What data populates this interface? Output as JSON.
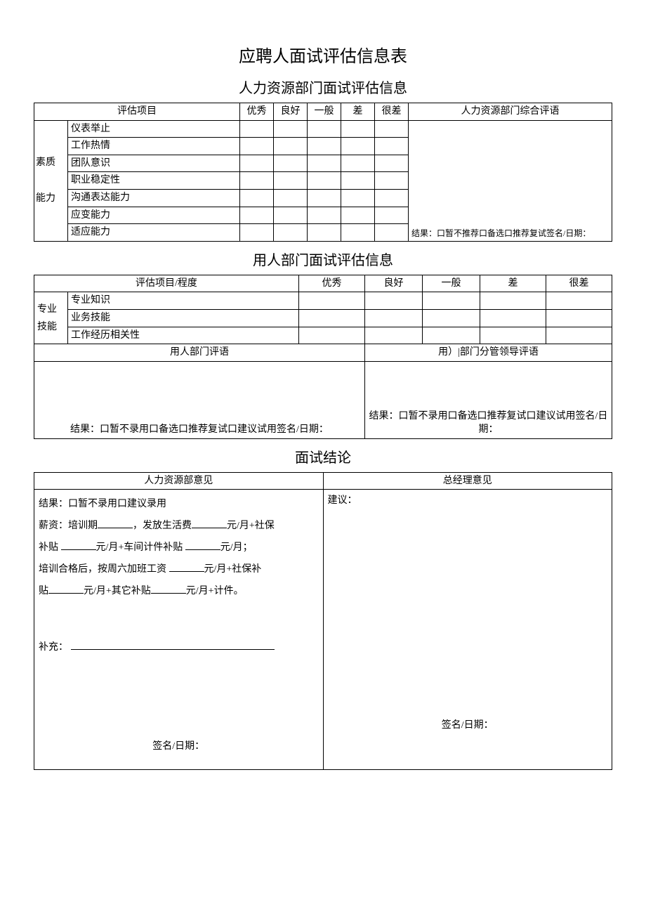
{
  "title": "应聘人面试评估信息表",
  "section1": {
    "heading": "人力资源部门面试评估信息",
    "colItem": "评估项目",
    "ratings": [
      "优秀",
      "良好",
      "一般",
      "差",
      "很差"
    ],
    "colComment": "人力资源部门综合评语",
    "group": "素质 能力",
    "rows": [
      "仪表举止",
      "工作热情",
      "团队意识",
      "职业稳定性",
      "沟通表达能力",
      "应变能力",
      "适应能力"
    ],
    "result": "结果：口暂不推荐口备选口推荐复试签名/日期："
  },
  "section2": {
    "heading": "用人部门面试评估信息",
    "colItem": "评估项目/程度",
    "ratings": [
      "优秀",
      "良好",
      "一般",
      "差",
      "很差"
    ],
    "group": "专业 技能",
    "rows": [
      "专业知识",
      "业务技能",
      "工作经历相关性"
    ],
    "deptCommentHdr": "用人部门评语",
    "leaderCommentHdr": "用）|部门分管领导评语",
    "resultLeft": "结果：口暂不录用口备选口推荐复试口建议试用签名/日期：",
    "resultRight": "结果：口暂不录用口备选口推荐复试口建议试用签名/日期："
  },
  "section3": {
    "heading": "面试结论",
    "hrHdr": "人力资源部意见",
    "gmHdr": "总经理意见",
    "hrLine1": "结果：口暂不录用口建议录用",
    "hrLine2a": "薪资：培训期",
    "hrLine2b": "，发放生活费",
    "hrLine2c": "元/月+社保",
    "hrLine3a": "补贴",
    "hrLine3b": "元/月+车间计件补贴",
    "hrLine3c": "元/月；",
    "hrLine4a": "培训合格后，按周六加班工资",
    "hrLine4b": "元/月+社保补",
    "hrLine5a": "贴",
    "hrLine5b": "元/月+其它补贴",
    "hrLine5c": "元/月+计件。",
    "supplement": "补充：",
    "sigDate": "签名/日期：",
    "gmSuggest": "建议：",
    "gmSigDate": "签名/日期："
  }
}
